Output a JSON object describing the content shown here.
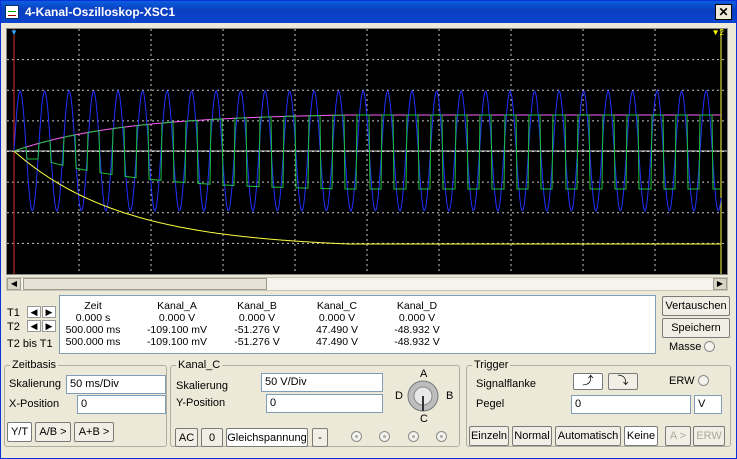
{
  "window": {
    "title": "4-Kanal-Oszilloskop-XSC1",
    "close": "✕"
  },
  "colors": {
    "channel_a": "#ffff40",
    "channel_b": "#20c040",
    "channel_c": "#2030ff",
    "channel_d": "#ff60ff",
    "background": "#000000",
    "grid": "#c8c8c8"
  },
  "cursors": {
    "t1_marker": "▼",
    "t2_marker": "▼2"
  },
  "readout": {
    "row_labels": [
      "T1",
      "T2",
      "T2 bis T1"
    ],
    "headers": [
      "Zeit",
      "Kanal_A",
      "Kanal_B",
      "Kanal_C",
      "Kanal_D"
    ],
    "rows": [
      [
        "0.000 s",
        "0.000 V",
        "0.000 V",
        "0.000 V",
        "0.000 V"
      ],
      [
        "500.000 ms",
        "-109.100 mV",
        "-51.276 V",
        "47.490 V",
        "-48.932 V"
      ],
      [
        "500.000 ms",
        "-109.100 mV",
        "-51.276 V",
        "47.490 V",
        "-48.932 V"
      ]
    ]
  },
  "actions": {
    "vertauschen": "Vertauschen",
    "speichern": "Speichern",
    "masse": "Masse"
  },
  "zeitbasis": {
    "title": "Zeitbasis",
    "skalierung_label": "Skalierung",
    "skalierung_value": "50 ms/Div",
    "xpos_label": "X-Position",
    "xpos_value": "0",
    "modes": [
      "Y/T",
      "A/B >",
      "A+B >"
    ]
  },
  "kanal": {
    "title": "Kanal_C",
    "skalierung_label": "Skalierung",
    "skalierung_value": "50  V/Div",
    "ypos_label": "Y-Position",
    "ypos_value": "0",
    "coupling": [
      "AC",
      "0",
      "Gleichspannung",
      "-"
    ],
    "knob_labels": [
      "A",
      "B",
      "C",
      "D"
    ]
  },
  "trigger": {
    "title": "Trigger",
    "flanke_label": "Signalflanke",
    "flanke_rise": "⤴",
    "flanke_fall": "⤵",
    "erw_label": "ERW",
    "pegel_label": "Pegel",
    "pegel_value": "0",
    "pegel_unit": "V",
    "modes": [
      "Einzeln",
      "Normal",
      "Automatisch",
      "Keine"
    ],
    "extra": [
      "A >",
      "ERW"
    ]
  }
}
